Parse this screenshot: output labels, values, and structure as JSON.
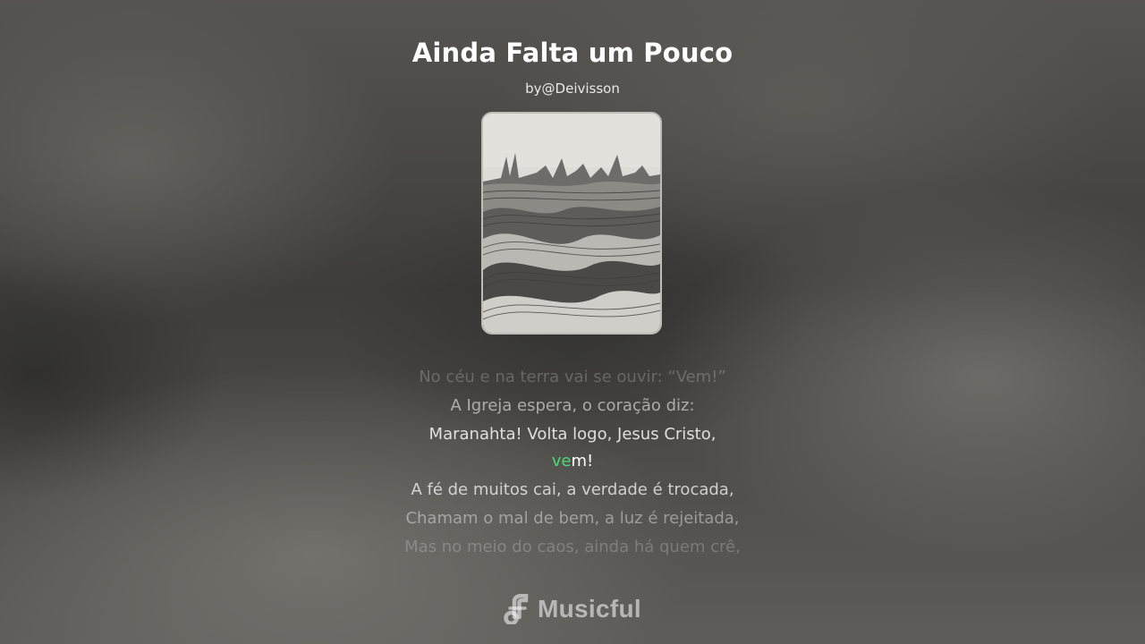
{
  "song": {
    "title": "Ainda Falta um Pouco",
    "artist": "by@Deivisson"
  },
  "lyrics": {
    "lines": [
      "No céu e na terra vai se ouvir: “Vem!”",
      "A Igreja espera, o coração diz:",
      "Maranahta! Volta logo, Jesus Cristo,",
      "",
      "A fé de muitos cai, a verdade é trocada,",
      "Chamam o mal de bem, a luz é rejeitada,",
      "Mas no meio do caos, ainda há quem crê,"
    ],
    "current_line": {
      "sung": "ve",
      "unsung": "m!"
    },
    "highlight_color": "#4fd873"
  },
  "brand": {
    "name": "Musicful",
    "icon": "music-note-icon"
  }
}
